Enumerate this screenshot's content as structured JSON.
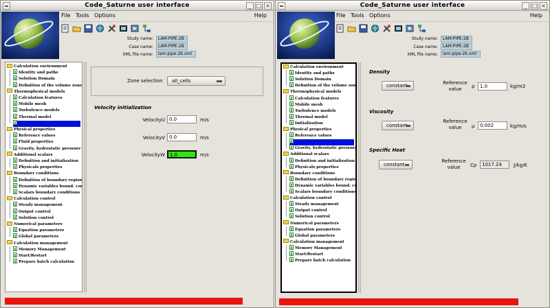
{
  "app": {
    "title": "Code_Saturne user interface"
  },
  "menus": {
    "file": "File",
    "tools": "Tools",
    "options": "Options",
    "help": "Help"
  },
  "info": {
    "study_label": "Study name:",
    "study_value": "LAM-PIPE-2B",
    "case_label": "Case name:",
    "case_value": "LAM-PIPE-2B",
    "xml_label": "XML file name:",
    "xml_value": "lam-pipe-2b.xml"
  },
  "toolbar_icons": [
    "new-file-icon",
    "open-folder-icon",
    "save-icon",
    "globe-icon",
    "tools-icon",
    "film-icon",
    "run-icon",
    "network-icon"
  ],
  "left_tree": [
    {
      "label": "Calculation environment",
      "kind": "folder"
    },
    {
      "label": "Identity and paths",
      "kind": "page"
    },
    {
      "label": "Solution Domain",
      "kind": "page"
    },
    {
      "label": "Definition of the volume zones",
      "kind": "page"
    },
    {
      "label": "Thermophysical models",
      "kind": "folder"
    },
    {
      "label": "Calculation features",
      "kind": "page"
    },
    {
      "label": "Mobile mesh",
      "kind": "page"
    },
    {
      "label": "Turbulence models",
      "kind": "page"
    },
    {
      "label": "Thermal model",
      "kind": "page"
    },
    {
      "label": "",
      "kind": "page",
      "selected": true
    },
    {
      "label": "Physical properties",
      "kind": "folder"
    },
    {
      "label": "Reference values",
      "kind": "page"
    },
    {
      "label": "Fluid properties",
      "kind": "page"
    },
    {
      "label": "Gravity, hydrostatic pressure",
      "kind": "page"
    },
    {
      "label": "Additional scalars",
      "kind": "folder"
    },
    {
      "label": "Definition and initialization",
      "kind": "page"
    },
    {
      "label": "Physicals properties",
      "kind": "page"
    },
    {
      "label": "Boundary conditions",
      "kind": "folder"
    },
    {
      "label": "Definition of boundary regions",
      "kind": "page"
    },
    {
      "label": "Dynamic variables bound. cond.",
      "kind": "page"
    },
    {
      "label": "Scalars boundary conditions",
      "kind": "page"
    },
    {
      "label": "Calculation control",
      "kind": "folder"
    },
    {
      "label": "Steady management",
      "kind": "page"
    },
    {
      "label": "Output control",
      "kind": "page"
    },
    {
      "label": "Solution control",
      "kind": "page"
    },
    {
      "label": "Numerical parameters",
      "kind": "folder"
    },
    {
      "label": "Equation parameters",
      "kind": "page"
    },
    {
      "label": "Global parameters",
      "kind": "page"
    },
    {
      "label": "Calculation management",
      "kind": "folder"
    },
    {
      "label": "Memory Management",
      "kind": "page"
    },
    {
      "label": "Start/Restart",
      "kind": "page"
    },
    {
      "label": "Prepare batch calculation",
      "kind": "page"
    }
  ],
  "right_tree": [
    {
      "label": "Calculation environment",
      "kind": "folder"
    },
    {
      "label": "Identity and paths",
      "kind": "page"
    },
    {
      "label": "Solution Domain",
      "kind": "page"
    },
    {
      "label": "Definition of the volume zones",
      "kind": "page"
    },
    {
      "label": "Thermophysical models",
      "kind": "folder"
    },
    {
      "label": "Calculation features",
      "kind": "page"
    },
    {
      "label": "Mobile mesh",
      "kind": "page"
    },
    {
      "label": "Turbulence models",
      "kind": "page"
    },
    {
      "label": "Thermal model",
      "kind": "page"
    },
    {
      "label": "Initialization",
      "kind": "page"
    },
    {
      "label": "Physical properties",
      "kind": "folder"
    },
    {
      "label": "Reference values",
      "kind": "page"
    },
    {
      "label": "",
      "kind": "page",
      "selected": true
    },
    {
      "label": "Gravity, hydrostatic pressure",
      "kind": "page"
    },
    {
      "label": "Additional scalars",
      "kind": "folder"
    },
    {
      "label": "Definition and initialization",
      "kind": "page"
    },
    {
      "label": "Physicals properties",
      "kind": "page"
    },
    {
      "label": "Boundary conditions",
      "kind": "folder"
    },
    {
      "label": "Definition of boundary regions",
      "kind": "page"
    },
    {
      "label": "Dynamic variables bound. cond.",
      "kind": "page"
    },
    {
      "label": "Scalars boundary conditions",
      "kind": "page"
    },
    {
      "label": "Calculation control",
      "kind": "folder"
    },
    {
      "label": "Steady management",
      "kind": "page"
    },
    {
      "label": "Output control",
      "kind": "page"
    },
    {
      "label": "Solution control",
      "kind": "page"
    },
    {
      "label": "Numerical parameters",
      "kind": "folder"
    },
    {
      "label": "Equation parameters",
      "kind": "page"
    },
    {
      "label": "Global parameters",
      "kind": "page"
    },
    {
      "label": "Calculation management",
      "kind": "folder"
    },
    {
      "label": "Memory Management",
      "kind": "page"
    },
    {
      "label": "Start/Restart",
      "kind": "page"
    },
    {
      "label": "Prepare batch calculation",
      "kind": "page"
    }
  ],
  "init_page": {
    "zone_label": "Zone selection",
    "zone_value": "all_cells",
    "section": "Velocity initialization",
    "rows": [
      {
        "label": "VelocityU",
        "value": "0.0",
        "unit": "m/s"
      },
      {
        "label": "VelocityV",
        "value": "0.0",
        "unit": "m/s"
      },
      {
        "label": "VelocityW",
        "value": "1.0",
        "unit": "m/s"
      }
    ]
  },
  "fluid_page": {
    "props": [
      {
        "title": "Density",
        "mode": "constant",
        "ref_label": "Reference value",
        "symbol": "ρ",
        "value": "1.0",
        "unit": "kg/m3"
      },
      {
        "title": "Viscosity",
        "mode": "constant",
        "ref_label": "Reference value",
        "symbol": "μ",
        "value": "0.002",
        "unit": "kg/m/s"
      },
      {
        "title": "Specific Heat",
        "mode": "constant",
        "ref_label": "Reference value",
        "symbol": "Cp",
        "value": "1017.24",
        "unit": "J/kg/K"
      }
    ]
  },
  "colors": {
    "selection": "#0010d8",
    "status_bar": "#e9140e",
    "active_field": "#2ee80e",
    "info_field": "#bcd0da"
  }
}
